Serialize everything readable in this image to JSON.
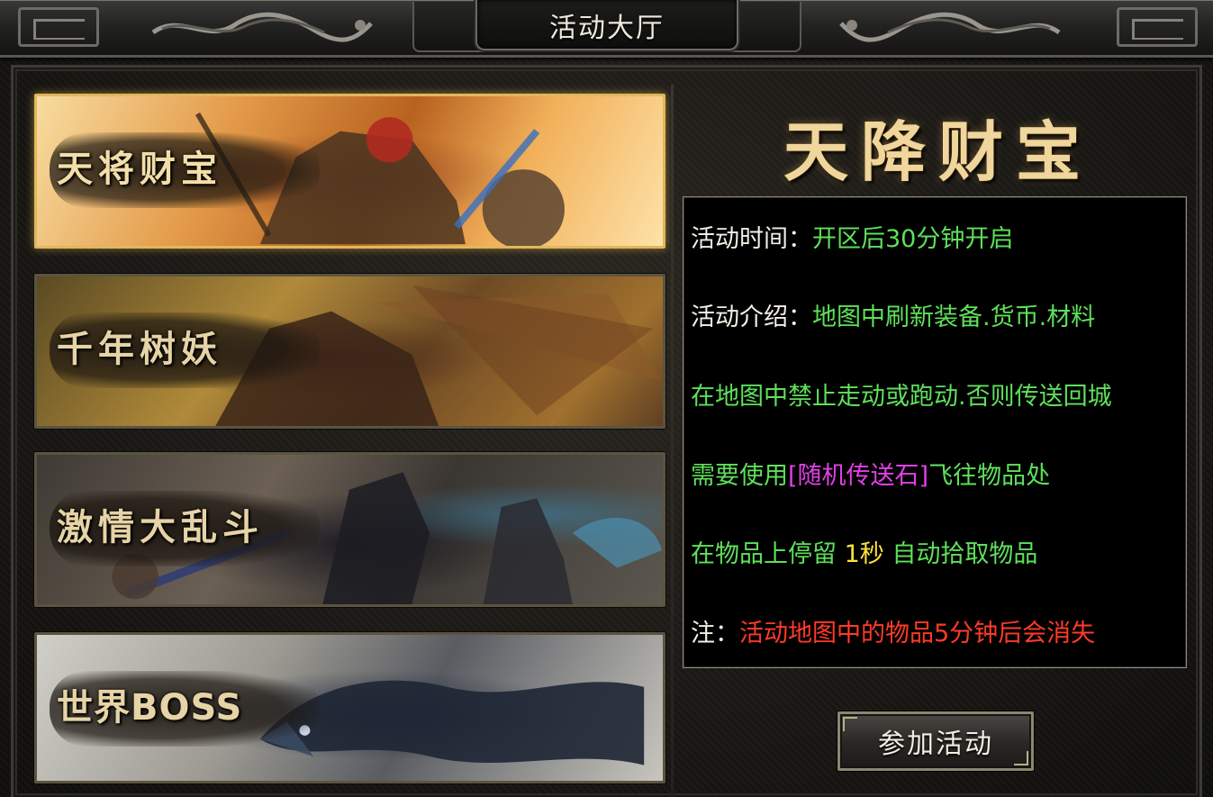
{
  "window": {
    "title": "活动大厅"
  },
  "events": [
    {
      "label": "天将财宝",
      "active": true
    },
    {
      "label": "千年树妖",
      "active": false
    },
    {
      "label": "激情大乱斗",
      "active": false
    },
    {
      "label": "世界BOSS",
      "active": false
    }
  ],
  "detail": {
    "title": "天降财宝",
    "time_label": "活动时间：",
    "time_value": "开区后30分钟开启",
    "intro_label": "活动介绍：",
    "intro_value": "地图中刷新装备.货币.材料",
    "rule1": "在地图中禁止走动或跑动.否则传送回城",
    "rule2_prefix": "需要使用",
    "rule2_item": "[随机传送石]",
    "rule2_suffix": "飞往物品处",
    "rule3_prefix": "在物品上停留",
    "rule3_value": "1秒",
    "rule3_suffix": "自动拾取物品",
    "note_label": "注：",
    "note_value": "活动地图中的物品5分钟后会消失"
  },
  "join_button": "参加活动",
  "colors": {
    "green_text": "#5ee05a",
    "magenta_text": "#e040e8",
    "yellow_text": "#ffe33a",
    "red_text": "#ff3a28",
    "gold_title": "#f0d69c"
  },
  "icons": [
    "dragon-ornament-left",
    "dragon-ornament-right"
  ]
}
